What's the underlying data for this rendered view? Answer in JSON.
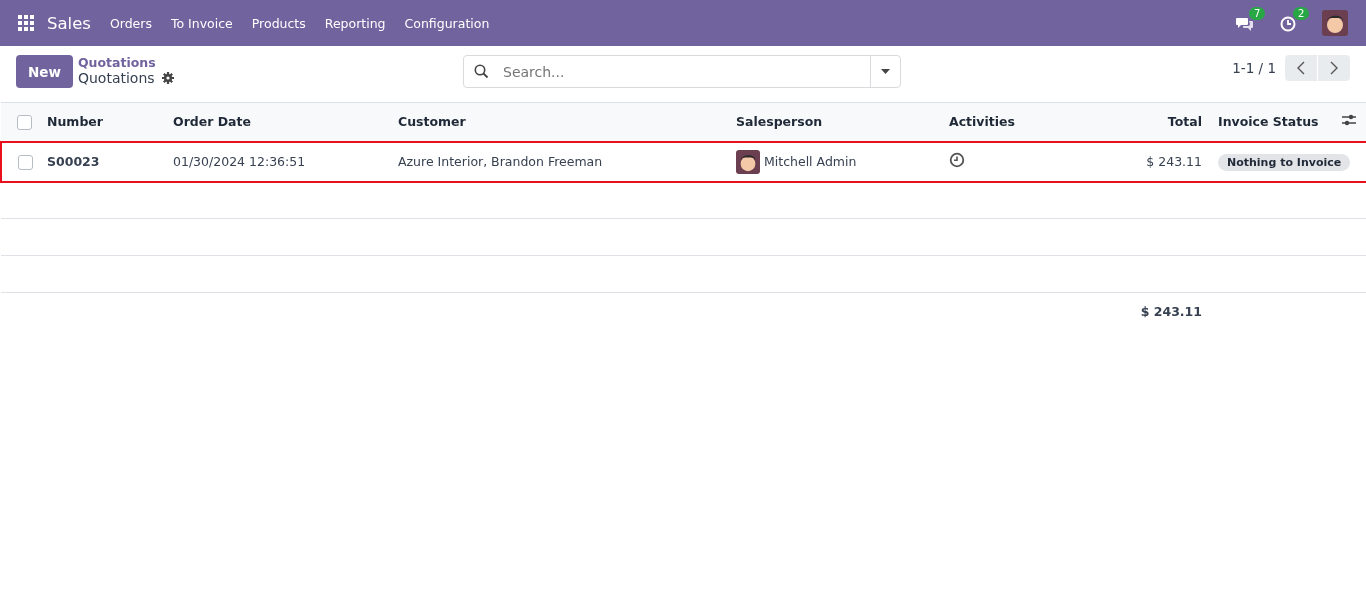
{
  "navbar": {
    "app": "Sales",
    "menu": [
      "Orders",
      "To Invoice",
      "Products",
      "Reporting",
      "Configuration"
    ],
    "messages_count": "7",
    "activities_count": "2"
  },
  "control_panel": {
    "new_button": "New",
    "breadcrumb": "Quotations",
    "title": "Quotations",
    "search": {
      "placeholder": "Search..."
    },
    "pager": "1-1 / 1"
  },
  "table": {
    "select_all_checked": false,
    "columns": [
      "Number",
      "Order Date",
      "Customer",
      "Salesperson",
      "Activities",
      "Total",
      "Invoice Status"
    ],
    "rows": [
      {
        "number": "S00023",
        "order_date": "01/30/2024 12:36:51",
        "customer": "Azure Interior, Brandon Freeman",
        "salesperson": "Mitchell Admin",
        "total": "$ 243.11",
        "invoice_status": "Nothing to Invoice",
        "checked": false,
        "highlighted": true
      }
    ],
    "footer_total": "$ 243.11"
  }
}
